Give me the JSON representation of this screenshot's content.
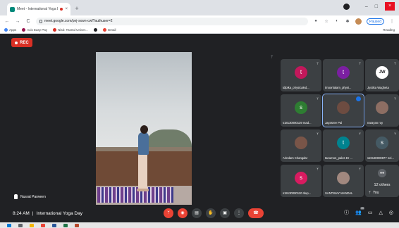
{
  "browser": {
    "tab_title": "Meet - International Yoga D",
    "tab_close": "×",
    "new_tab": "+",
    "url": "meet.google.com/pnj-sxwn-cwf?authuser=2",
    "paused_label": "Paused",
    "win_min": "–",
    "win_max": "□",
    "win_close": "×",
    "nav_back": "←",
    "nav_forward": "→",
    "nav_reload": "C"
  },
  "bookmarks": {
    "items": [
      {
        "label": "Apps",
        "color": "#4285f4"
      },
      {
        "label": "Axis Easy Pay",
        "color": "#97144d"
      },
      {
        "label": "Nisd: Teamd Univer...",
        "color": "#d93025"
      },
      {
        "label": "",
        "color": "#202124"
      },
      {
        "label": "Gmail",
        "color": "#ea4335"
      }
    ],
    "reading_list": "Reading"
  },
  "meet": {
    "rec_label": "REC",
    "speaker_name": "Nusrat Parween",
    "time": "8:24 AM",
    "separator": "|",
    "meeting_title": "International Yoga Day",
    "others_count": "12 others",
    "you_label": "You",
    "chat_badge": "19"
  },
  "tiles": [
    {
      "initial": "t",
      "name": "tdipika_physicaled...",
      "color": "#c2185b",
      "mic": "ᛘ"
    },
    {
      "initial": "t",
      "name": "tmoorkalam_physi...",
      "color": "#7b1fa2",
      "mic": "ᛘ"
    },
    {
      "initial": "JW",
      "name": "Jyotika Wagheta",
      "color": "#ffffff",
      "mic": "ᛘ"
    },
    {
      "initial": "s",
      "name": "s18130000139 mad...",
      "color": "#2e7d32",
      "mic": "ᛘ"
    },
    {
      "initial": "",
      "name": "Jayasree Pal",
      "color": "#6d4c41",
      "mic": ""
    },
    {
      "initial": "",
      "name": "narayan roy",
      "color": "#8d6e63",
      "mic": "ᛘ"
    },
    {
      "initial": "",
      "name": "Arindam Changdar",
      "color": "#795548",
      "mic": "ᛘ"
    },
    {
      "initial": "t",
      "name": "tanumon_pales Dr ...",
      "color": "#00838f",
      "mic": "ᛘ"
    },
    {
      "initial": "s",
      "name": "s19130000877 nei...",
      "color": "#455a64",
      "mic": "ᛘ"
    },
    {
      "initial": "s",
      "name": "s19130000110 ritup...",
      "color": "#d81b60",
      "mic": "ᛘ"
    },
    {
      "initial": "",
      "name": "SANTIMAY MANDAL",
      "color": "#a1887f",
      "mic": "ᛘ"
    }
  ],
  "colors": {
    "meet_bg": "#202124",
    "tile_bg": "#3c4043",
    "rec_red": "#d93025",
    "leave_red": "#ea4335",
    "active_outline": "#8ab4f8"
  }
}
